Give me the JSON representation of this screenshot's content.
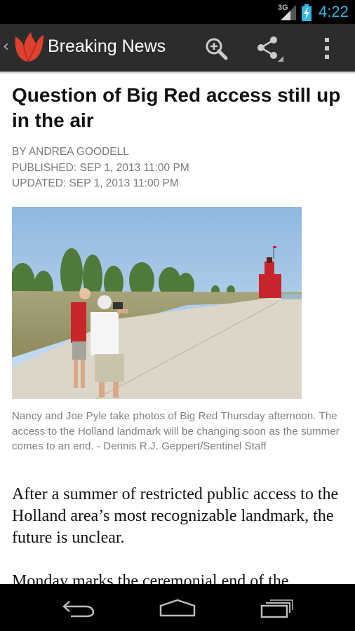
{
  "status_bar": {
    "network": "3G",
    "time": "4:22",
    "time_color": "#33b5e5"
  },
  "action_bar": {
    "title": "Breaking News",
    "logo_color": "#e0402f",
    "icons": [
      "up-caret-icon",
      "tulip-logo-icon",
      "zoom-icon",
      "share-icon",
      "overflow-menu-icon"
    ]
  },
  "article": {
    "headline": "Question of Big Red access still up in the air",
    "byline": "BY ANDREA GOODELL",
    "published": "PUBLISHED: SEP 1, 2013 11:00 PM",
    "updated": "UPDATED: SEP 1, 2013 11:00 PM",
    "photo_caption": "Nancy and Joe Pyle take photos of Big Red Thursday afternoon. The access to the Holland landmark will be changing soon as the summer comes to an end. - Dennis R.J. Geppert/Sentinel Staff",
    "paragraphs": [
      "After a summer of restricted public access to the Holland area’s most recognizable landmark, the future is unclear.",
      "Monday marks the ceremonial end of the"
    ]
  },
  "nav_bar": {
    "icons": [
      "back-icon",
      "home-icon",
      "recents-icon"
    ]
  }
}
